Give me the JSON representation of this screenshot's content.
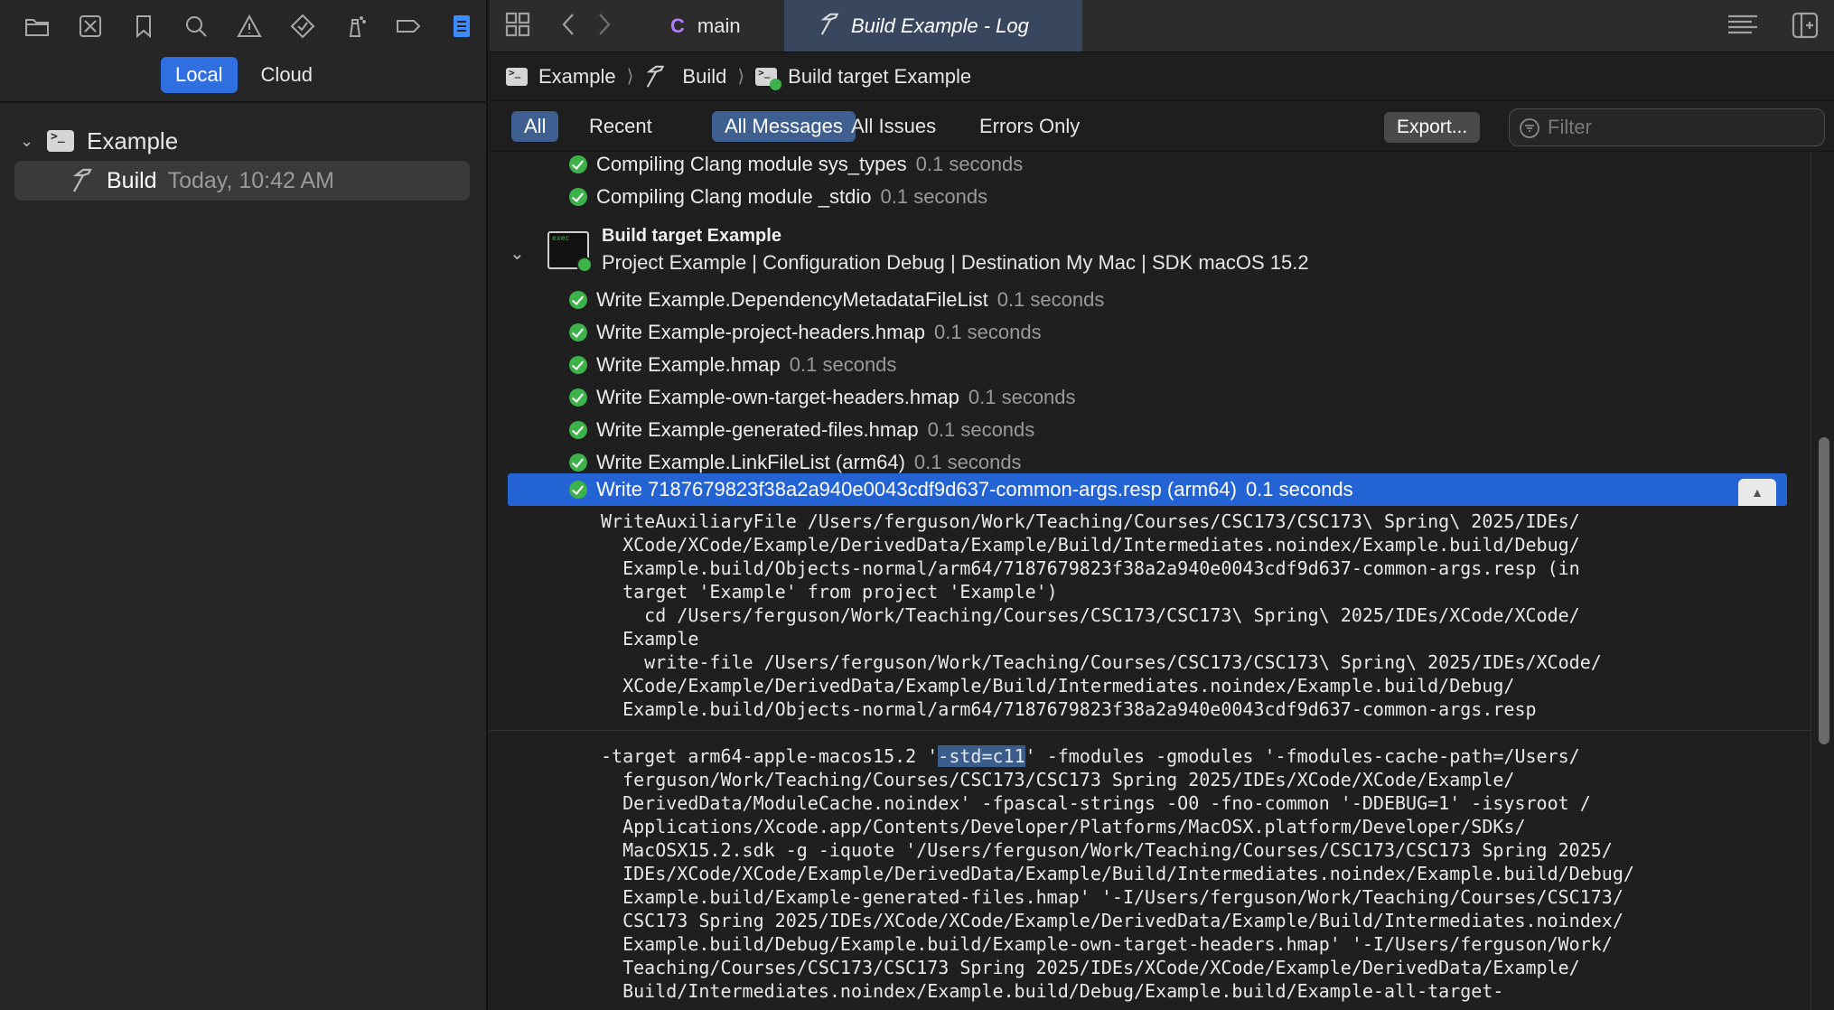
{
  "navigator": {
    "toolbar_icons": [
      "folder-icon",
      "source-control-icon",
      "bookmark-icon",
      "search-icon",
      "warning-icon",
      "test-icon",
      "debug-icon",
      "breakpoint-icon",
      "report-icon"
    ],
    "scope": {
      "local": "Local",
      "cloud": "Cloud",
      "selected": "Local"
    },
    "project": {
      "name": "Example"
    },
    "build_item": {
      "label": "Build",
      "time": "Today, 10:42 AM"
    }
  },
  "tabbar": {
    "branch_tab": {
      "icon": "C",
      "label": "main"
    },
    "active_tab": {
      "label": "Build Example - Log"
    }
  },
  "jumpbar": {
    "items": [
      "Example",
      "Build",
      "Build target Example"
    ]
  },
  "filterbar": {
    "all": "All",
    "recent": "Recent",
    "all_messages": "All Messages",
    "all_issues": "All Issues",
    "errors_only": "Errors Only",
    "export": "Export...",
    "filter_placeholder": "Filter"
  },
  "log": {
    "top_rows": [
      {
        "text": "Compiling Clang module sys_types",
        "duration": "0.1 seconds"
      },
      {
        "text": "Compiling Clang module _stdio",
        "duration": "0.1 seconds"
      }
    ],
    "target": {
      "title": "Build target Example",
      "subtitle": "Project Example | Configuration Debug | Destination My Mac | SDK macOS 15.2"
    },
    "rows": [
      {
        "text": "Write Example.DependencyMetadataFileList",
        "duration": "0.1 seconds"
      },
      {
        "text": "Write Example-project-headers.hmap",
        "duration": "0.1 seconds"
      },
      {
        "text": "Write Example.hmap",
        "duration": "0.1 seconds"
      },
      {
        "text": "Write Example-own-target-headers.hmap",
        "duration": "0.1 seconds"
      },
      {
        "text": "Write Example-generated-files.hmap",
        "duration": "0.1 seconds"
      },
      {
        "text": "Write Example.LinkFileList (arm64)",
        "duration": "0.1 seconds"
      }
    ],
    "selected_row": {
      "text": "Write 7187679823f38a2a940e0043cdf9d637-common-args.resp (arm64)",
      "duration": "0.1 seconds"
    },
    "detail_1": "WriteAuxiliaryFile /Users/ferguson/Work/Teaching/Courses/CSC173/CSC173\\ Spring\\ 2025/IDEs/\n  XCode/XCode/Example/DerivedData/Example/Build/Intermediates.noindex/Example.build/Debug/\n  Example.build/Objects-normal/arm64/7187679823f38a2a940e0043cdf9d637-common-args.resp (in\n  target 'Example' from project 'Example')\n    cd /Users/ferguson/Work/Teaching/Courses/CSC173/CSC173\\ Spring\\ 2025/IDEs/XCode/XCode/\n  Example\n    write-file /Users/ferguson/Work/Teaching/Courses/CSC173/CSC173\\ Spring\\ 2025/IDEs/XCode/\n  XCode/Example/DerivedData/Example/Build/Intermediates.noindex/Example.build/Debug/\n  Example.build/Objects-normal/arm64/7187679823f38a2a940e0043cdf9d637-common-args.resp",
    "detail_2_prefix": "-target arm64-apple-macos15.2 '",
    "detail_2_highlight": "-std=c11",
    "detail_2_rest": "' -fmodules -gmodules '-fmodules-cache-path=/Users/\n  ferguson/Work/Teaching/Courses/CSC173/CSC173 Spring 2025/IDEs/XCode/XCode/Example/\n  DerivedData/ModuleCache.noindex' -fpascal-strings -O0 -fno-common '-DDEBUG=1' -isysroot /\n  Applications/Xcode.app/Contents/Developer/Platforms/MacOSX.platform/Developer/SDKs/\n  MacOSX15.2.sdk -g -iquote '/Users/ferguson/Work/Teaching/Courses/CSC173/CSC173 Spring 2025/\n  IDEs/XCode/XCode/Example/DerivedData/Example/Build/Intermediates.noindex/Example.build/Debug/\n  Example.build/Example-generated-files.hmap' '-I/Users/ferguson/Work/Teaching/Courses/CSC173/\n  CSC173 Spring 2025/IDEs/XCode/XCode/Example/DerivedData/Example/Build/Intermediates.noindex/\n  Example.build/Debug/Example.build/Example-own-target-headers.hmap' '-I/Users/ferguson/Work/\n  Teaching/Courses/CSC173/CSC173 Spring 2025/IDEs/XCode/XCode/Example/DerivedData/Example/\n  Build/Intermediates.noindex/Example.build/Debug/Example.build/Example-all-target-"
  },
  "colors": {
    "accent": "#2f6fe0",
    "selection": "#2463d4",
    "success": "#3cb24a",
    "branch": "#b07cff"
  }
}
